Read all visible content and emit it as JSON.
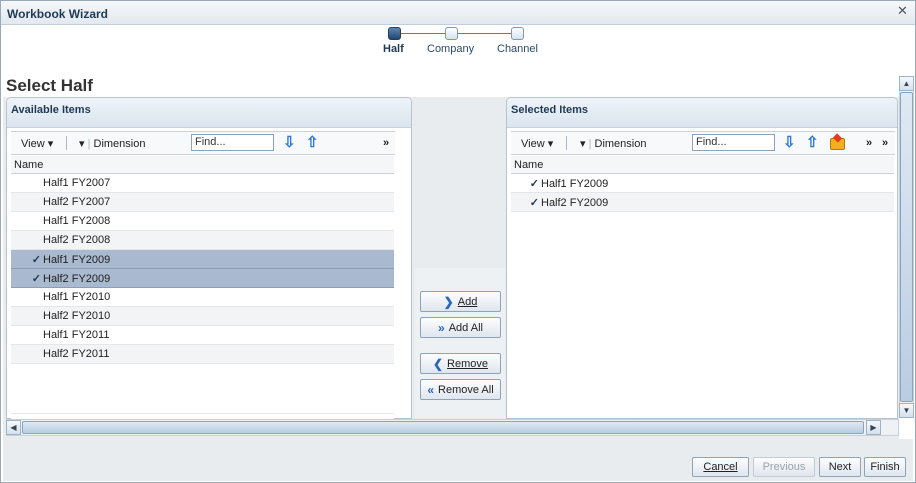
{
  "window": {
    "title": "Workbook Wizard",
    "close_glyph": "✕"
  },
  "train": {
    "steps": [
      {
        "label": "Half",
        "active": true
      },
      {
        "label": "Company",
        "active": false
      },
      {
        "label": "Channel",
        "active": false
      }
    ]
  },
  "page_title": "Select Half",
  "available": {
    "title": "Available Items",
    "toolbar": {
      "view": "View",
      "dimension": "Dimension",
      "find_placeholder": "Find...",
      "more": "»"
    },
    "column": "Name",
    "rows": [
      {
        "label": "Half1 FY2007",
        "selected": false
      },
      {
        "label": "Half2 FY2007",
        "selected": false
      },
      {
        "label": "Half1 FY2008",
        "selected": false
      },
      {
        "label": "Half2 FY2008",
        "selected": false
      },
      {
        "label": "Half1 FY2009",
        "selected": true
      },
      {
        "label": "Half2 FY2009",
        "selected": true
      },
      {
        "label": "Half1 FY2010",
        "selected": false
      },
      {
        "label": "Half2 FY2010",
        "selected": false
      },
      {
        "label": "Half1 FY2011",
        "selected": false
      },
      {
        "label": "Half2 FY2011",
        "selected": false
      }
    ]
  },
  "selected": {
    "title": "Selected Items",
    "toolbar": {
      "view": "View",
      "dimension": "Dimension",
      "find_placeholder": "Find...",
      "more": "»"
    },
    "column": "Name",
    "rows": [
      {
        "label": "Half1 FY2009"
      },
      {
        "label": "Half2 FY2009"
      }
    ]
  },
  "shuttle": {
    "add": "Add",
    "add_all": "Add All",
    "remove": "Remove",
    "remove_all": "Remove All"
  },
  "footer": {
    "cancel": "Cancel",
    "previous": "Previous",
    "next": "Next",
    "finish": "Finish"
  },
  "colors": {
    "accent": "#1f3a56",
    "selection": "#a9b9cf",
    "arrow": "#2a78d8"
  }
}
